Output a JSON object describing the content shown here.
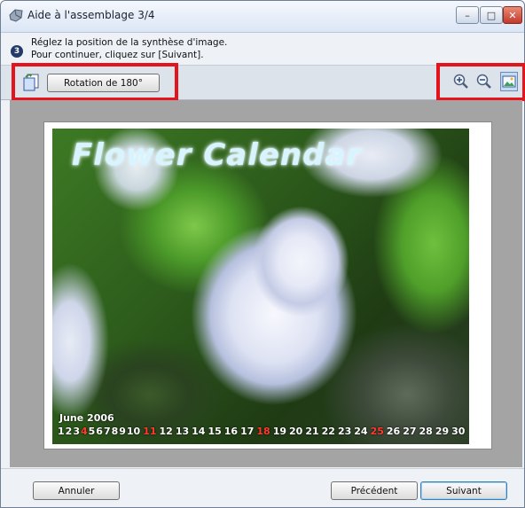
{
  "window": {
    "title": "Aide à l'assemblage 3/4",
    "controls": {
      "minimize": "–",
      "maximize": "□",
      "close": "✕"
    }
  },
  "instructions": {
    "step_number": "3",
    "line1": "Réglez la position de la synthèse d'image.",
    "line2": "Pour continuer, cliquez sur [Suivant]."
  },
  "toolbar": {
    "rotate_icon": "rotate-icon",
    "rotate_label": "Rotation de 180°",
    "zoom_in_icon": "zoom-in-icon",
    "zoom_out_icon": "zoom-out-icon",
    "fit_icon": "fit-to-window-icon"
  },
  "preview": {
    "calendar_title": "Flower Calendar",
    "month_label": "June 2006",
    "days": [
      "1",
      "2",
      "3",
      "4",
      "5",
      "6",
      "7",
      "8",
      "9",
      "10",
      "11",
      "12",
      "13",
      "14",
      "15",
      "16",
      "17",
      "18",
      "19",
      "20",
      "21",
      "22",
      "23",
      "24",
      "25",
      "26",
      "27",
      "28",
      "29",
      "30"
    ],
    "red_days": [
      "4",
      "11",
      "18",
      "25"
    ],
    "red_color": "#ff3a2e"
  },
  "footer": {
    "cancel_label": "Annuler",
    "previous_label": "Précédent",
    "next_label": "Suivant"
  },
  "colors": {
    "highlight_box": "#e3141c",
    "canvas_bg": "#a4a4a4"
  }
}
